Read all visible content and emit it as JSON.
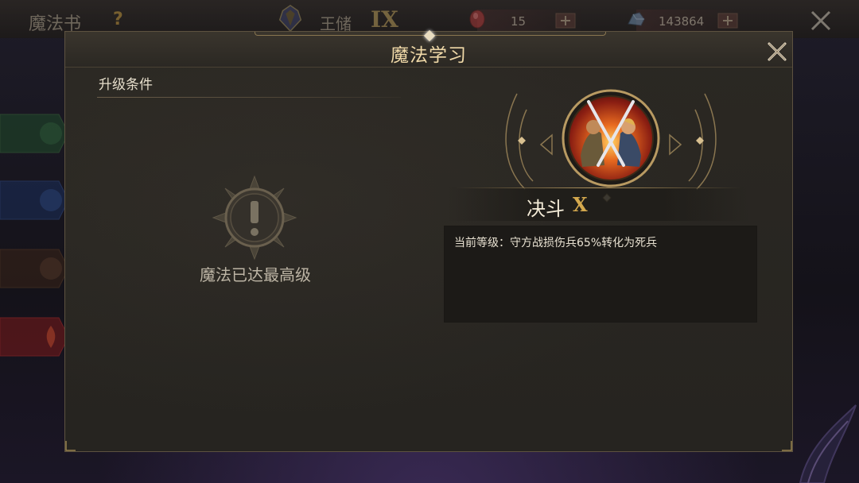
{
  "header": {
    "title": "魔法书",
    "help_icon": "?",
    "rank_name": "王储",
    "rank_level": "IX",
    "resources": [
      {
        "icon": "gem-icon",
        "value": "15"
      },
      {
        "icon": "ore-icon",
        "value": "143864"
      }
    ]
  },
  "dialog": {
    "title": "魔法学习",
    "left": {
      "section_title": "升级条件",
      "max_message": "魔法已达最高级"
    },
    "right": {
      "skill_name": "决斗",
      "skill_level": "X",
      "description": "当前等级：守方战损伤兵65%转化为死兵"
    }
  },
  "colors": {
    "accent_gold": "#d4a94e",
    "title_gold": "#f0d9a8",
    "panel_bg": "#2a2722",
    "desc_bg": "#1c1a17"
  }
}
